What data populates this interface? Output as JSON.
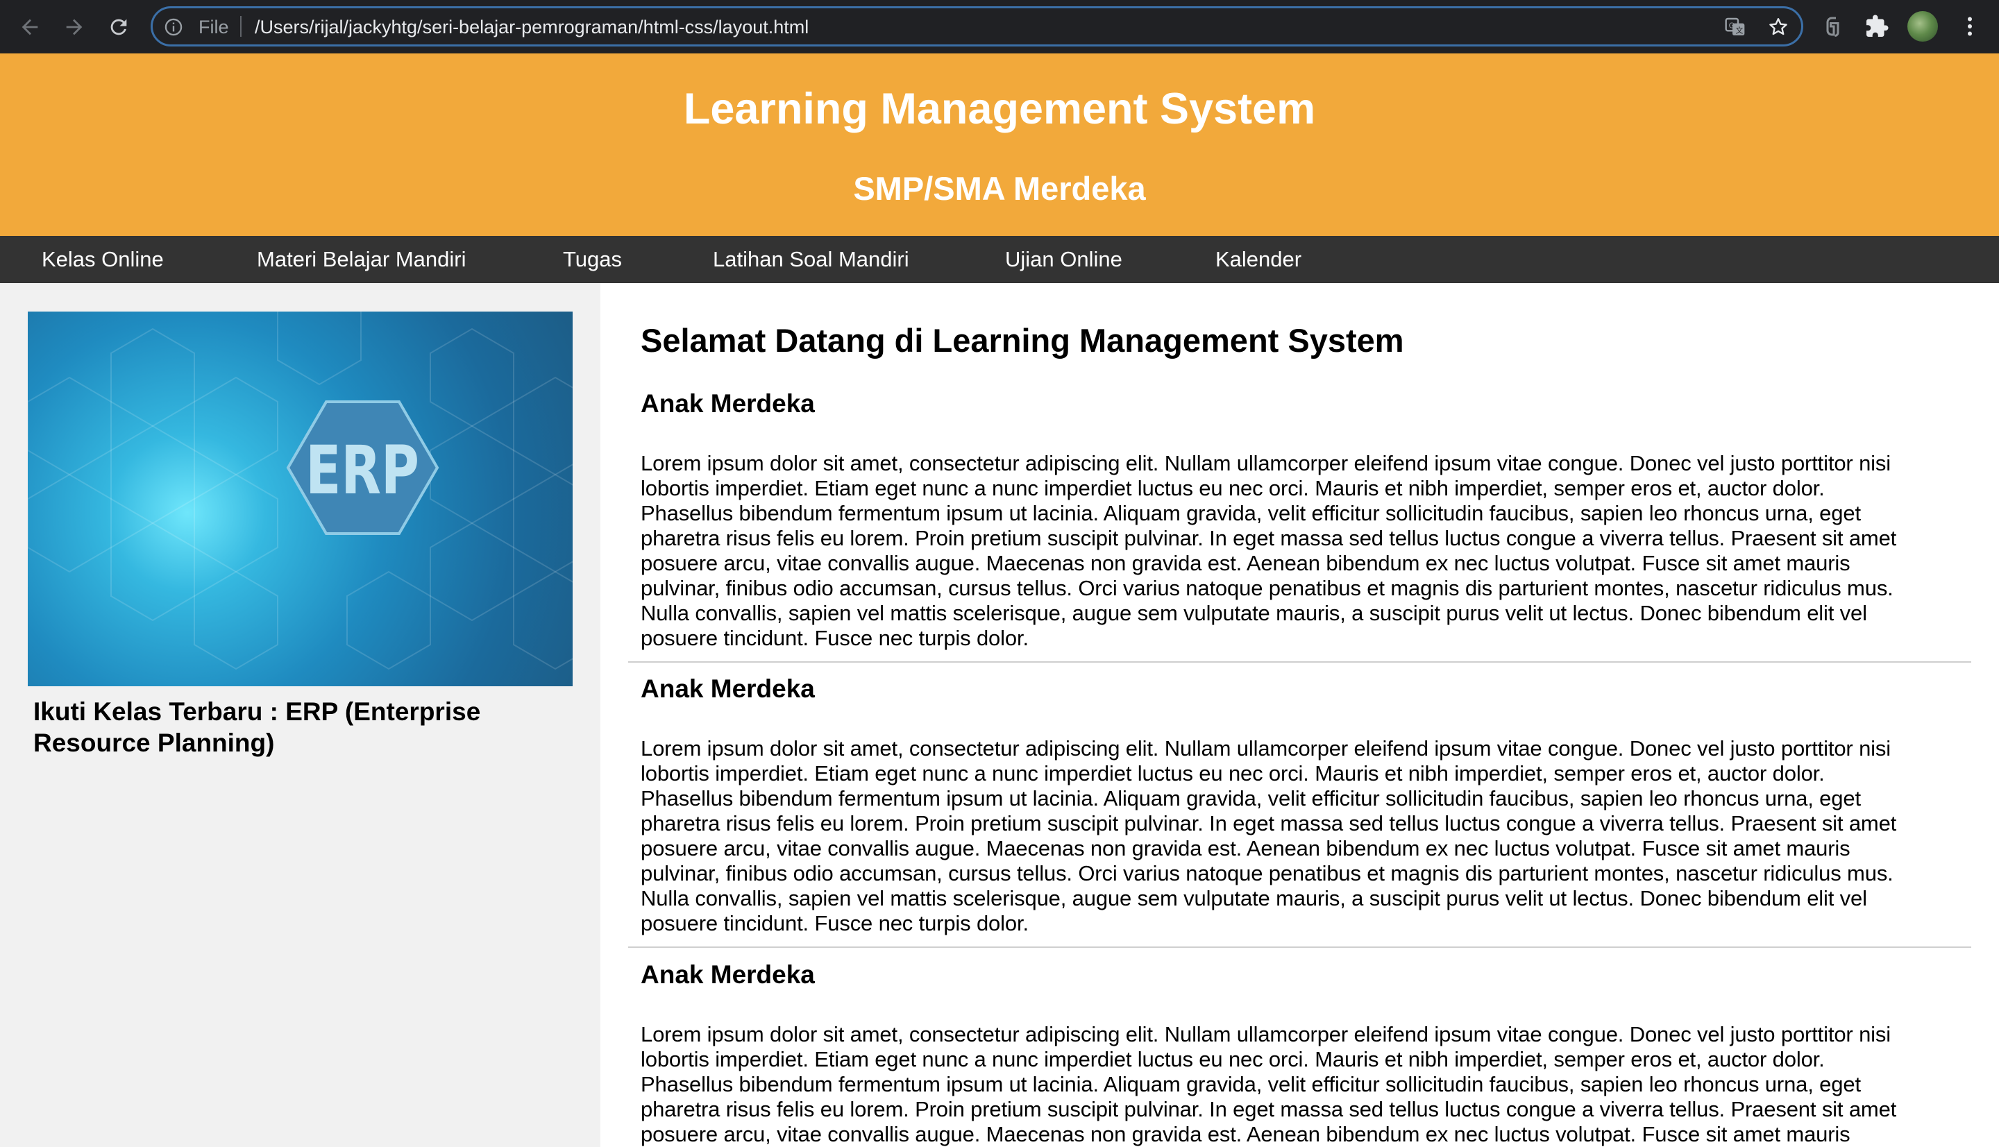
{
  "browser": {
    "file_label": "File",
    "url": "/Users/rijal/jackyhtg/seri-belajar-pemrograman/html-css/layout.html",
    "icons": [
      "back-arrow-icon",
      "forward-arrow-icon",
      "reload-icon",
      "info-icon",
      "translate-icon",
      "star-icon",
      "extension-icon",
      "puzzle-icon",
      "profile-avatar",
      "menu-dots-icon"
    ]
  },
  "header": {
    "title": "Learning Management System",
    "subtitle": "SMP/SMA Merdeka",
    "background_color": "#f2a93b"
  },
  "nav": {
    "items": [
      {
        "label": "Kelas Online"
      },
      {
        "label": "Materi Belajar Mandiri"
      },
      {
        "label": "Tugas"
      },
      {
        "label": "Latihan Soal Mandiri"
      },
      {
        "label": "Ujian Online"
      },
      {
        "label": "Kalender"
      }
    ],
    "background_color": "#333333"
  },
  "sidebar": {
    "image_text": "ERP",
    "caption": "Ikuti Kelas Terbaru : ERP (Enterprise Resource Planning)"
  },
  "main": {
    "title": "Selamat Datang di Learning Management System",
    "articles": [
      {
        "heading": "Anak Merdeka",
        "lines": [
          "Lorem ipsum dolor sit amet, consectetur adipiscing elit. Nullam ullamcorper eleifend ipsum vitae congue. Donec vel justo porttitor nisi",
          "lobortis imperdiet. Etiam eget nunc a nunc imperdiet luctus eu nec orci. Mauris et nibh imperdiet, semper eros et, auctor dolor.",
          "Phasellus bibendum fermentum ipsum ut lacinia. Aliquam gravida, velit efficitur sollicitudin faucibus, sapien leo rhoncus urna, eget",
          "pharetra risus felis eu lorem. Proin pretium suscipit pulvinar. In eget massa sed tellus luctus congue a viverra tellus. Praesent sit amet",
          "posuere arcu, vitae convallis augue. Maecenas non gravida est. Aenean bibendum ex nec luctus volutpat. Fusce sit amet mauris",
          "pulvinar, finibus odio accumsan, cursus tellus. Orci varius natoque penatibus et magnis dis parturient montes, nascetur ridiculus mus.",
          "Nulla convallis, sapien vel mattis scelerisque, augue sem vulputate mauris, a suscipit purus velit ut lectus. Donec bibendum elit vel",
          "posuere tincidunt. Fusce nec turpis dolor."
        ]
      },
      {
        "heading": "Anak Merdeka",
        "lines": [
          "Lorem ipsum dolor sit amet, consectetur adipiscing elit. Nullam ullamcorper eleifend ipsum vitae congue. Donec vel justo porttitor nisi",
          "lobortis imperdiet. Etiam eget nunc a nunc imperdiet luctus eu nec orci. Mauris et nibh imperdiet, semper eros et, auctor dolor.",
          "Phasellus bibendum fermentum ipsum ut lacinia. Aliquam gravida, velit efficitur sollicitudin faucibus, sapien leo rhoncus urna, eget",
          "pharetra risus felis eu lorem. Proin pretium suscipit pulvinar. In eget massa sed tellus luctus congue a viverra tellus. Praesent sit amet",
          "posuere arcu, vitae convallis augue. Maecenas non gravida est. Aenean bibendum ex nec luctus volutpat. Fusce sit amet mauris",
          "pulvinar, finibus odio accumsan, cursus tellus. Orci varius natoque penatibus et magnis dis parturient montes, nascetur ridiculus mus.",
          "Nulla convallis, sapien vel mattis scelerisque, augue sem vulputate mauris, a suscipit purus velit ut lectus. Donec bibendum elit vel",
          "posuere tincidunt. Fusce nec turpis dolor."
        ]
      },
      {
        "heading": "Anak Merdeka",
        "lines": [
          "Lorem ipsum dolor sit amet, consectetur adipiscing elit. Nullam ullamcorper eleifend ipsum vitae congue. Donec vel justo porttitor nisi",
          "lobortis imperdiet. Etiam eget nunc a nunc imperdiet luctus eu nec orci. Mauris et nibh imperdiet, semper eros et, auctor dolor.",
          "Phasellus bibendum fermentum ipsum ut lacinia. Aliquam gravida, velit efficitur sollicitudin faucibus, sapien leo rhoncus urna, eget",
          "pharetra risus felis eu lorem. Proin pretium suscipit pulvinar. In eget massa sed tellus luctus congue a viverra tellus. Praesent sit amet",
          "posuere arcu, vitae convallis augue. Maecenas non gravida est. Aenean bibendum ex nec luctus volutpat. Fusce sit amet mauris"
        ]
      }
    ]
  }
}
